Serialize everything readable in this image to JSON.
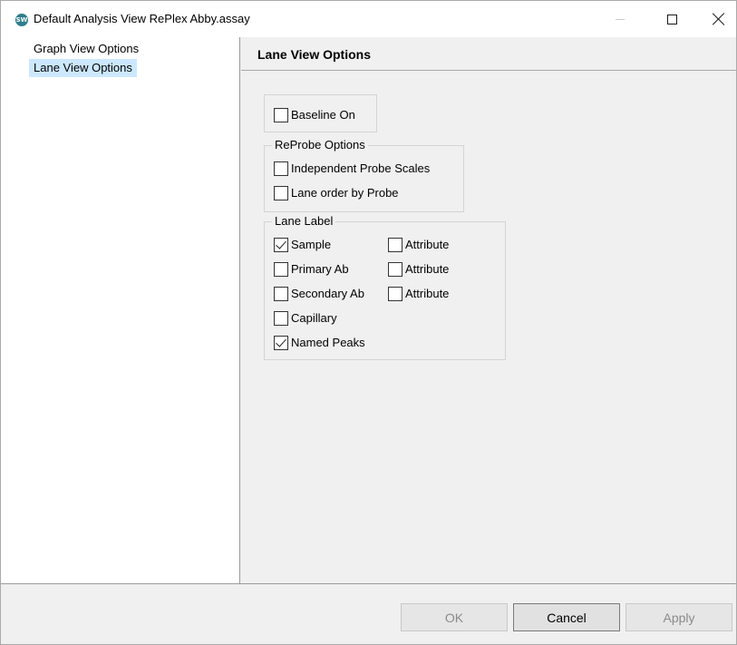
{
  "window": {
    "app_icon_text": "SW",
    "title": "Default Analysis View RePlex Abby.assay"
  },
  "sidebar": {
    "items": [
      {
        "label": "Graph View Options",
        "selected": false
      },
      {
        "label": "Lane View Options",
        "selected": true
      }
    ]
  },
  "main": {
    "header": "Lane View Options",
    "baseline": {
      "label": "Baseline On",
      "checked": false
    },
    "reprobe": {
      "title": "ReProbe Options",
      "independent_scales": {
        "label": "Independent Probe Scales",
        "checked": false
      },
      "lane_order": {
        "label": "Lane order by Probe",
        "checked": false
      }
    },
    "lane_label": {
      "title": "Lane Label",
      "sample": {
        "label": "Sample",
        "checked": true
      },
      "sample_attr": {
        "label": "Attribute",
        "checked": false
      },
      "primary_ab": {
        "label": "Primary Ab",
        "checked": false
      },
      "primary_attr": {
        "label": "Attribute",
        "checked": false
      },
      "secondary_ab": {
        "label": "Secondary Ab",
        "checked": false
      },
      "secondary_attr": {
        "label": "Attribute",
        "checked": false
      },
      "capillary": {
        "label": "Capillary",
        "checked": false
      },
      "named_peaks": {
        "label": "Named Peaks",
        "checked": true
      }
    }
  },
  "footer": {
    "ok": {
      "label": "OK",
      "enabled": false
    },
    "cancel": {
      "label": "Cancel",
      "enabled": true
    },
    "apply": {
      "label": "Apply",
      "enabled": false
    }
  }
}
